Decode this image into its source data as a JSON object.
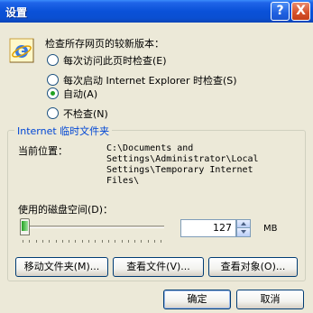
{
  "window": {
    "title": "设置"
  },
  "titlebar": {
    "help_glyph": "?",
    "close_glyph": "X"
  },
  "icons": {
    "ie": "internet-explorer-icon"
  },
  "check": {
    "heading": "检查所存网页的较新版本：",
    "options": [
      {
        "label": "每次访问此页时检查(E)",
        "checked": false
      },
      {
        "label": "每次启动 Internet Explorer 时检查(S)",
        "checked": false
      },
      {
        "label": "自动(A)",
        "checked": true
      },
      {
        "label": "不检查(N)",
        "checked": false
      }
    ]
  },
  "temp": {
    "group_title": "Internet 临时文件夹",
    "location_label": "当前位置：",
    "location_path": "C:\\Documents and\nSettings\\Administrator\\Local\nSettings\\Temporary Internet\nFiles\\",
    "disk_label": "使用的磁盘空间(D)：",
    "disk_value": "127",
    "disk_unit": "MB",
    "slider_level": 0.02
  },
  "buttons": {
    "move_folder": "移动文件夹(M)...",
    "view_files": "查看文件(V)...",
    "view_objects": "查看对象(O)...",
    "ok": "确定",
    "cancel": "取消"
  },
  "colors": {
    "titlebar": "#0a51d8",
    "group_title": "#0046d5",
    "radio_dot": "#21a121"
  }
}
